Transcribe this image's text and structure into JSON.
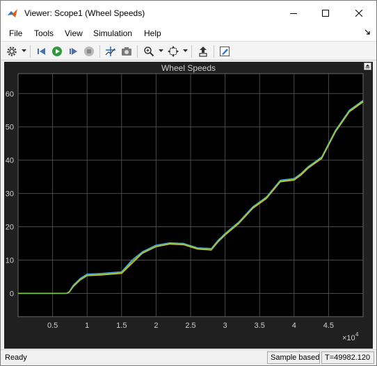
{
  "window": {
    "title": "Viewer: Scope1 (Wheel Speeds)",
    "icons": [
      "matlab-app-icon",
      "minimize-icon",
      "maximize-icon",
      "close-icon"
    ]
  },
  "menu": {
    "items": [
      "File",
      "Tools",
      "View",
      "Simulation",
      "Help"
    ]
  },
  "toolbar": {
    "icons": [
      "gear-icon",
      "step-back-icon",
      "run-icon",
      "step-forward-icon",
      "stop-icon",
      "cursor-measure-icon",
      "snapshot-icon",
      "zoom-in-icon",
      "fit-axes-icon",
      "highlight-block-icon",
      "edit-style-icon"
    ]
  },
  "scope": {
    "title": "Wheel Speeds",
    "background_color": "#000000",
    "frame_color": "#202020",
    "grid_color": "#4a4a4a",
    "text_color": "#d0d0d0"
  },
  "status": {
    "ready": "Ready",
    "mode": "Sample based",
    "time": "T=49982.120"
  },
  "chart_data": {
    "type": "line",
    "title": "Wheel Speeds",
    "xlabel": "",
    "ylabel": "",
    "x_exponent_label": "×10",
    "x_exponent": "4",
    "xlim": [
      0,
      50000
    ],
    "ylim": [
      -7,
      66
    ],
    "x_ticks": [
      5000,
      10000,
      15000,
      20000,
      25000,
      30000,
      35000,
      40000,
      45000
    ],
    "x_tick_labels": [
      "0.5",
      "1",
      "1.5",
      "2",
      "2.5",
      "3",
      "3.5",
      "4",
      "4.5"
    ],
    "y_ticks": [
      0,
      10,
      20,
      30,
      40,
      50,
      60
    ],
    "y_tick_labels": [
      "0",
      "10",
      "20",
      "30",
      "40",
      "50",
      "60"
    ],
    "grid": true,
    "series": [
      {
        "color": "#4da6e8",
        "x": [
          0,
          7000,
          7400,
          8000,
          9000,
          10000,
          12000,
          15000,
          16500,
          18000,
          20000,
          22000,
          24000,
          26000,
          28000,
          29000,
          30000,
          32000,
          34000,
          36000,
          38000,
          40000,
          41000,
          42000,
          44000,
          46000,
          48000,
          50000
        ],
        "y": [
          0,
          0,
          0.5,
          2.5,
          4.5,
          5.8,
          6.0,
          6.5,
          10,
          12.5,
          14.5,
          15.2,
          15,
          13.7,
          13.5,
          16,
          18,
          21.5,
          26,
          29,
          34,
          34.5,
          36,
          38,
          41,
          49,
          55,
          58
        ]
      },
      {
        "color": "#e8c020",
        "x": [
          0,
          7000,
          7400,
          8000,
          9000,
          10000,
          12000,
          15000,
          16500,
          18000,
          20000,
          22000,
          24000,
          26000,
          28000,
          29000,
          30000,
          32000,
          34000,
          36000,
          38000,
          40000,
          41000,
          42000,
          44000,
          46000,
          48000,
          50000
        ],
        "y": [
          0,
          0,
          0.3,
          2,
          4,
          5.3,
          5.5,
          6,
          9,
          12,
          14,
          14.8,
          14.6,
          13.3,
          13,
          15.5,
          17.5,
          21,
          25.5,
          28.5,
          33.5,
          34,
          35.5,
          37.5,
          40.5,
          48.5,
          54.5,
          57.5
        ]
      },
      {
        "color": "#7fc840",
        "x": [
          0,
          7000,
          7400,
          8000,
          9000,
          10000,
          12000,
          15000,
          16500,
          18000,
          20000,
          22000,
          24000,
          26000,
          28000,
          29000,
          30000,
          32000,
          34000,
          36000,
          38000,
          40000,
          41000,
          42000,
          44000,
          46000,
          48000,
          50000
        ],
        "y": [
          0,
          0,
          0.4,
          2.2,
          4.2,
          5.5,
          5.7,
          6.2,
          9.5,
          12.2,
          14.2,
          15,
          14.8,
          13.5,
          13.2,
          15.8,
          17.8,
          21.2,
          25.8,
          28.8,
          33.8,
          34.2,
          35.8,
          37.8,
          40.8,
          48.8,
          54.8,
          57.8
        ]
      }
    ]
  }
}
